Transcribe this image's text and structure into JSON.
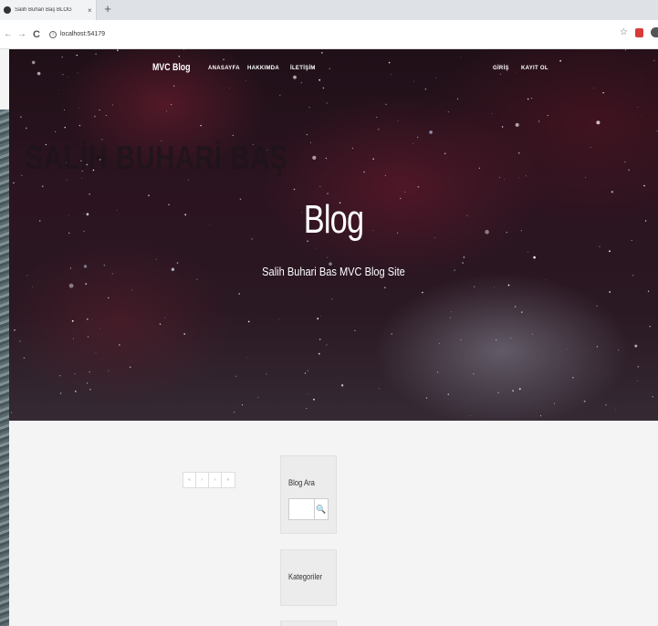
{
  "browser": {
    "tab_title": "Salih Buhari Baş BLOG",
    "tab_close": "×",
    "new_tab": "+",
    "back": "←",
    "forward": "→",
    "reload": "C",
    "info": "i",
    "url": "localhost:54179",
    "bookmark": "☆"
  },
  "site": {
    "brand": "MVC Blog",
    "nav_left": [
      "ANASAYFA",
      "HAKKIMDA",
      "İLETİŞİM"
    ],
    "nav_right": [
      "GİRİŞ",
      "KAYIT OL"
    ],
    "watermark": "SALİH BUHARİ BAŞ",
    "hero_title": "Blog",
    "hero_subtitle": "Salih Buhari Bas MVC Blog Site"
  },
  "pagination": [
    "«",
    "‹",
    "›",
    "»"
  ],
  "sidebar": {
    "search_title": "Blog Ara",
    "search_button": "🔍",
    "categories_title": "Kategoriler"
  },
  "colors": {
    "accent_red": "#d93a3a",
    "hero_dark": "#201018",
    "content_bg": "#f4f4f4"
  }
}
